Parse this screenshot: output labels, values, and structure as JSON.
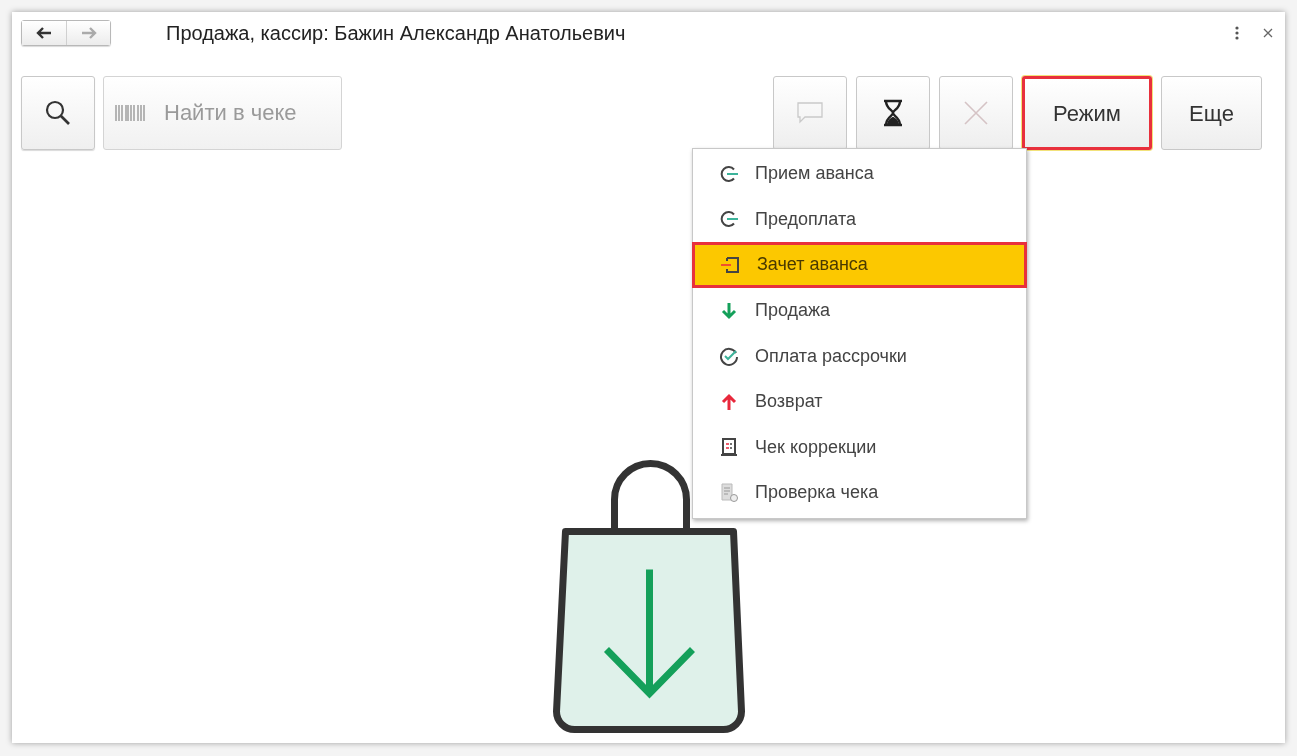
{
  "window": {
    "title": "Продажа, кассир: Бажин Александр Анатольевич",
    "back_disabled": false,
    "forward_disabled": true
  },
  "toolbar": {
    "search_placeholder": "Найти в чеке",
    "buttons": [
      {
        "kind": "comment",
        "disabled": true,
        "outlined": false
      },
      {
        "kind": "hourglass",
        "disabled": false,
        "outlined": false
      },
      {
        "kind": "cancel",
        "disabled": true,
        "outlined": false
      },
      {
        "kind": "text",
        "label": "Режим",
        "disabled": false,
        "outlined": true
      },
      {
        "kind": "text",
        "label": "Еще",
        "disabled": false,
        "outlined": false
      }
    ]
  },
  "mode_menu": {
    "items": [
      {
        "label": "Прием аванса",
        "kind": "advance",
        "selected": false
      },
      {
        "label": "Предоплата",
        "kind": "advance",
        "selected": false
      },
      {
        "label": "Зачет аванса",
        "kind": "offset",
        "selected": true
      },
      {
        "label": "Продажа",
        "kind": "sale",
        "selected": false
      },
      {
        "label": "Оплата рассрочки",
        "kind": "installment",
        "selected": false
      },
      {
        "label": "Возврат",
        "kind": "refund",
        "selected": false
      },
      {
        "label": "Чек коррекции",
        "kind": "correction",
        "selected": false
      },
      {
        "label": "Проверка чека",
        "kind": "check",
        "selected": false
      }
    ]
  }
}
